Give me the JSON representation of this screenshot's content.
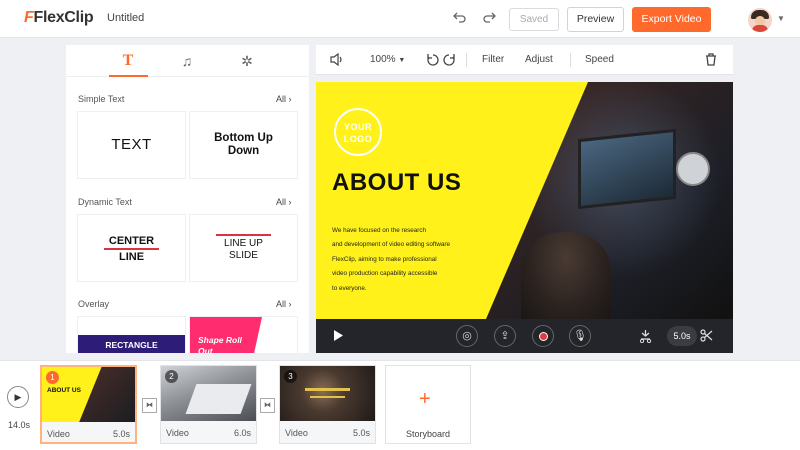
{
  "header": {
    "logo": "FlexClip",
    "doc_title": "Untitled",
    "saved_label": "Saved",
    "preview_label": "Preview",
    "export_label": "Export Video"
  },
  "left_panel": {
    "tabs": [
      "text-icon",
      "music-icon",
      "settings-icon"
    ],
    "active_tab": 0,
    "sections": [
      {
        "title": "Simple Text",
        "all": "All",
        "cards": [
          "TEXT",
          "Bottom Up Down"
        ]
      },
      {
        "title": "Dynamic Text",
        "all": "All",
        "cards": [
          "CENTER LINE",
          "LINE UP SLIDE"
        ]
      },
      {
        "title": "Overlay",
        "all": "All",
        "cards": [
          "RECTANGLE",
          "Shape Roll Out"
        ]
      }
    ]
  },
  "toolbar": {
    "zoom": "100%",
    "filter_label": "Filter",
    "adjust_label": "Adjust",
    "speed_label": "Speed"
  },
  "canvas": {
    "logo_text": "YOUR LOGO",
    "heading": "ABOUT US",
    "paragraph_lines": [
      "We have focused on the research",
      "and development of video editing software",
      "FlexClip, aiming to make professional",
      "video production capability accessible",
      "to everyone."
    ],
    "accent_color": "#fff119"
  },
  "player": {
    "duration": "5.0s"
  },
  "timeline": {
    "total_duration": "14.0s",
    "clips": [
      {
        "number": "1",
        "type": "Video",
        "duration": "5.0s"
      },
      {
        "number": "2",
        "type": "Video",
        "duration": "6.0s"
      },
      {
        "number": "3",
        "type": "Video",
        "duration": "5.0s"
      }
    ],
    "storyboard_label": "Storyboard"
  },
  "colors": {
    "brand": "#ff6a2c"
  }
}
